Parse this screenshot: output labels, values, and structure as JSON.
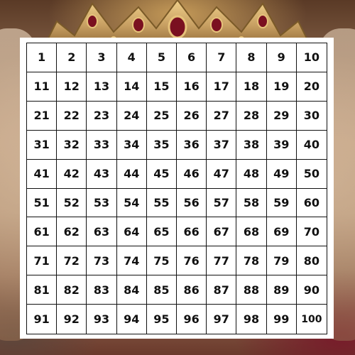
{
  "grid": {
    "rows": 10,
    "columns": 10,
    "cells": [
      "1",
      "2",
      "3",
      "4",
      "5",
      "6",
      "7",
      "8",
      "9",
      "10",
      "11",
      "12",
      "13",
      "14",
      "15",
      "16",
      "17",
      "18",
      "19",
      "20",
      "21",
      "22",
      "23",
      "24",
      "25",
      "26",
      "27",
      "28",
      "29",
      "30",
      "31",
      "32",
      "33",
      "34",
      "35",
      "36",
      "37",
      "38",
      "39",
      "40",
      "41",
      "42",
      "43",
      "44",
      "45",
      "46",
      "47",
      "48",
      "49",
      "50",
      "51",
      "52",
      "53",
      "54",
      "55",
      "56",
      "57",
      "58",
      "59",
      "60",
      "61",
      "62",
      "63",
      "64",
      "65",
      "66",
      "67",
      "68",
      "69",
      "70",
      "71",
      "72",
      "73",
      "74",
      "75",
      "76",
      "77",
      "78",
      "79",
      "80",
      "81",
      "82",
      "83",
      "84",
      "85",
      "86",
      "87",
      "88",
      "89",
      "90",
      "91",
      "92",
      "93",
      "94",
      "95",
      "96",
      "97",
      "98",
      "99",
      "100"
    ]
  },
  "colors": {
    "board": "#ffffff",
    "lines": "#111111",
    "text": "#111111",
    "crown_gold": "#c8a063",
    "jewel_red": "#7a1020"
  },
  "background": {
    "subject": "crown-image"
  }
}
